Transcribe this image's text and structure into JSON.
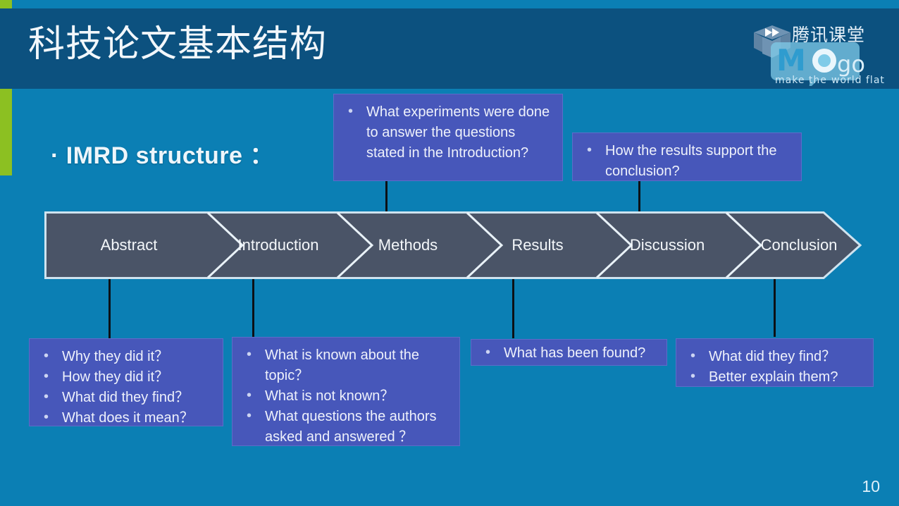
{
  "slide": {
    "title": "科技论文基本结构",
    "heading": "· IMRD structure ：",
    "page_number": "10",
    "colors": {
      "background": "#0b7fb4",
      "title_band": "#0c517f",
      "accent_green": "#8cc022",
      "chevron_fill": "#4a5467",
      "chevron_stroke": "#cfe3ef",
      "callout_fill": "#4757ba",
      "connector": "#0c1116"
    }
  },
  "logo": {
    "brand_cn": "腾讯课堂",
    "brand_main": "MOgo",
    "tagline": "make the world flat",
    "icon": "graduation-cap-fast-forward-icon"
  },
  "flow": {
    "steps": [
      {
        "label": "Abstract"
      },
      {
        "label": "Introduction"
      },
      {
        "label": "Methods"
      },
      {
        "label": "Results"
      },
      {
        "label": "Discussion"
      },
      {
        "label": "Conclusion"
      }
    ]
  },
  "callouts": {
    "methods": {
      "name": "methods-callout",
      "items": [
        "What experiments were done to answer the questions stated in the Introduction?"
      ]
    },
    "discussion": {
      "name": "discussion-callout",
      "items": [
        "How the results support the conclusion?"
      ]
    },
    "abstract": {
      "name": "abstract-callout",
      "items": [
        "Why they did it？",
        "How they did it？",
        "What did they find？",
        "What does it mean？"
      ]
    },
    "introduction": {
      "name": "introduction-callout",
      "items": [
        "What is known about the topic？",
        "What is not known？",
        "What questions the authors asked and answered ？"
      ]
    },
    "results": {
      "name": "results-callout",
      "items": [
        "What has been found?"
      ]
    },
    "conclusion": {
      "name": "conclusion-callout",
      "items": [
        "What did they find？",
        "Better explain them?"
      ]
    }
  }
}
